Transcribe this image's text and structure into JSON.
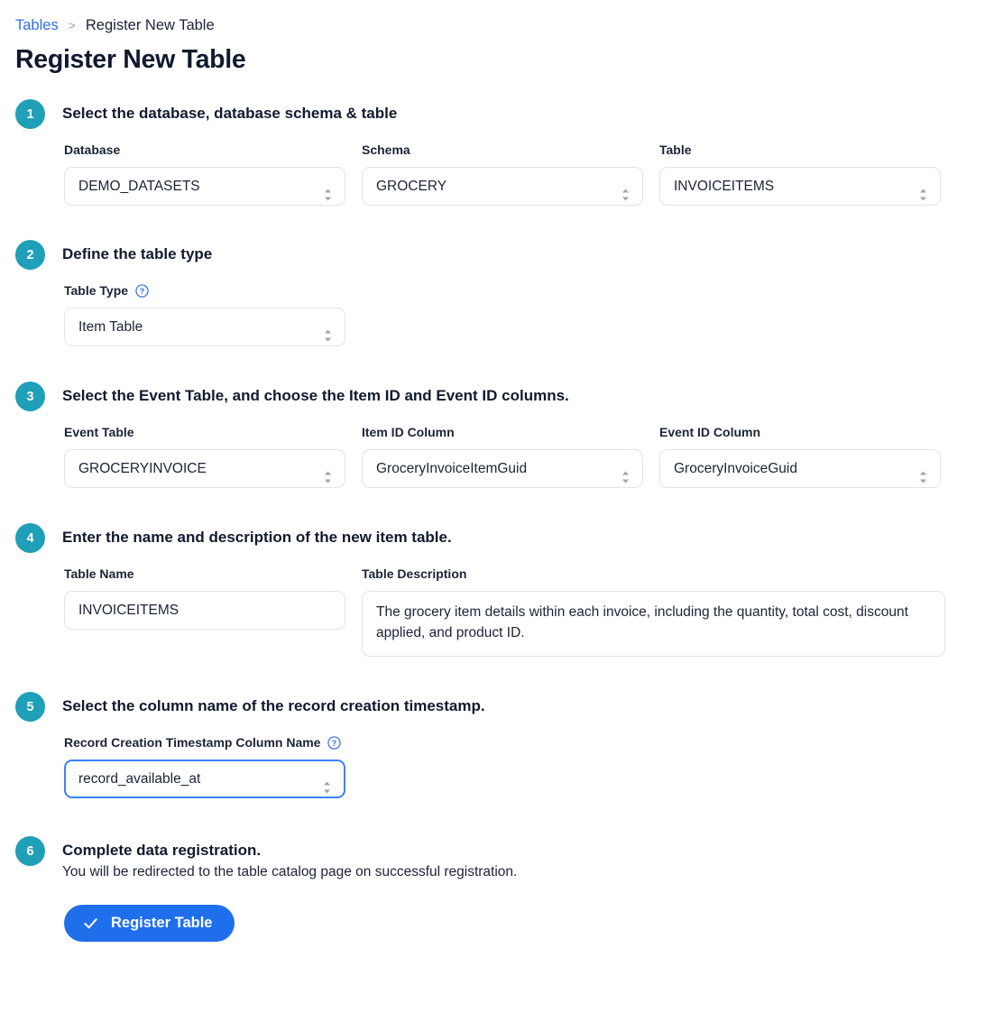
{
  "breadcrumb": {
    "root_label": "Tables",
    "separator": ">",
    "current_label": "Register New Table"
  },
  "page_title": "Register New Table",
  "icons": {
    "help": "question-mark-circle-icon",
    "select_chevron": "chevron-up-down-icon",
    "check": "check-icon"
  },
  "colors": {
    "step_badge": "#1f9fb8",
    "link": "#2f6fed",
    "primary_button": "#1f6fec",
    "focus_border": "#3b82f6",
    "field_border": "#dfe3eb"
  },
  "steps": [
    {
      "number": "1",
      "title": "Select the database, database schema & table",
      "fields": [
        {
          "label": "Database",
          "value": "DEMO_DATASETS",
          "type": "select"
        },
        {
          "label": "Schema",
          "value": "GROCERY",
          "type": "select"
        },
        {
          "label": "Table",
          "value": "INVOICEITEMS",
          "type": "select"
        }
      ]
    },
    {
      "number": "2",
      "title": "Define the table type",
      "fields": [
        {
          "label": "Table Type",
          "value": "Item Table",
          "type": "select",
          "help": true
        }
      ]
    },
    {
      "number": "3",
      "title": "Select the Event Table, and choose the Item ID and Event ID columns.",
      "fields": [
        {
          "label": "Event Table",
          "value": "GROCERYINVOICE",
          "type": "select"
        },
        {
          "label": "Item ID Column",
          "value": "GroceryInvoiceItemGuid",
          "type": "select"
        },
        {
          "label": "Event ID Column",
          "value": "GroceryInvoiceGuid",
          "type": "select"
        }
      ]
    },
    {
      "number": "4",
      "title": "Enter the name and description of the new item table.",
      "fields": [
        {
          "label": "Table Name",
          "value": "INVOICEITEMS",
          "type": "text"
        },
        {
          "label": "Table Description",
          "value": "The grocery item details within each invoice, including the quantity, total cost, discount applied, and product ID.",
          "type": "textarea"
        }
      ]
    },
    {
      "number": "5",
      "title": "Select the column name of the record creation timestamp.",
      "fields": [
        {
          "label": "Record Creation Timestamp Column Name",
          "value": "record_available_at",
          "type": "select",
          "help": true,
          "focused": true
        }
      ]
    },
    {
      "number": "6",
      "title": "Complete data registration.",
      "subtitle": "You will be redirected to the table catalog page on successful registration.",
      "button_label": "Register Table"
    }
  ]
}
